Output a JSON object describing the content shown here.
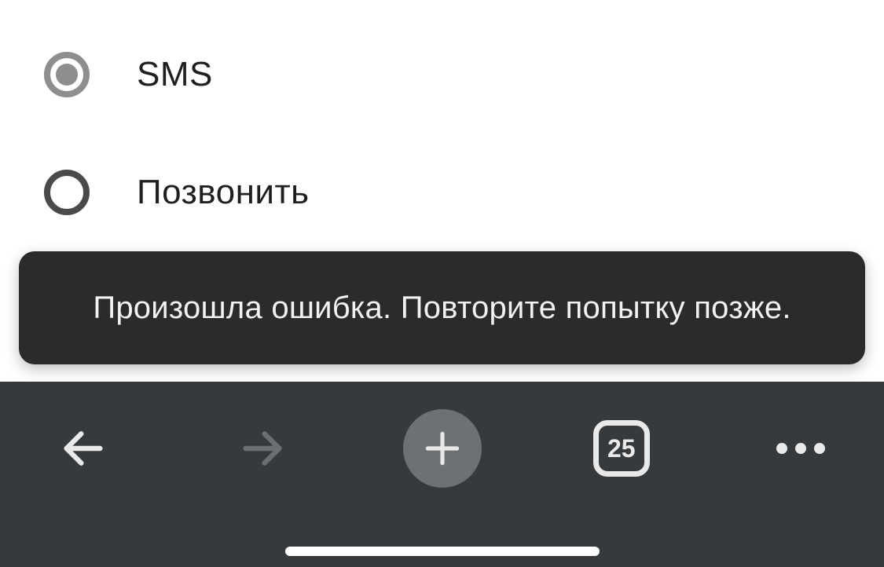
{
  "options": {
    "sms": {
      "label": "SMS",
      "selected": true
    },
    "call": {
      "label": "Позвонить",
      "selected": false
    }
  },
  "toast": {
    "message": "Произошла ошибка. Повторите попытку позже."
  },
  "navbar": {
    "tab_count": "25"
  }
}
